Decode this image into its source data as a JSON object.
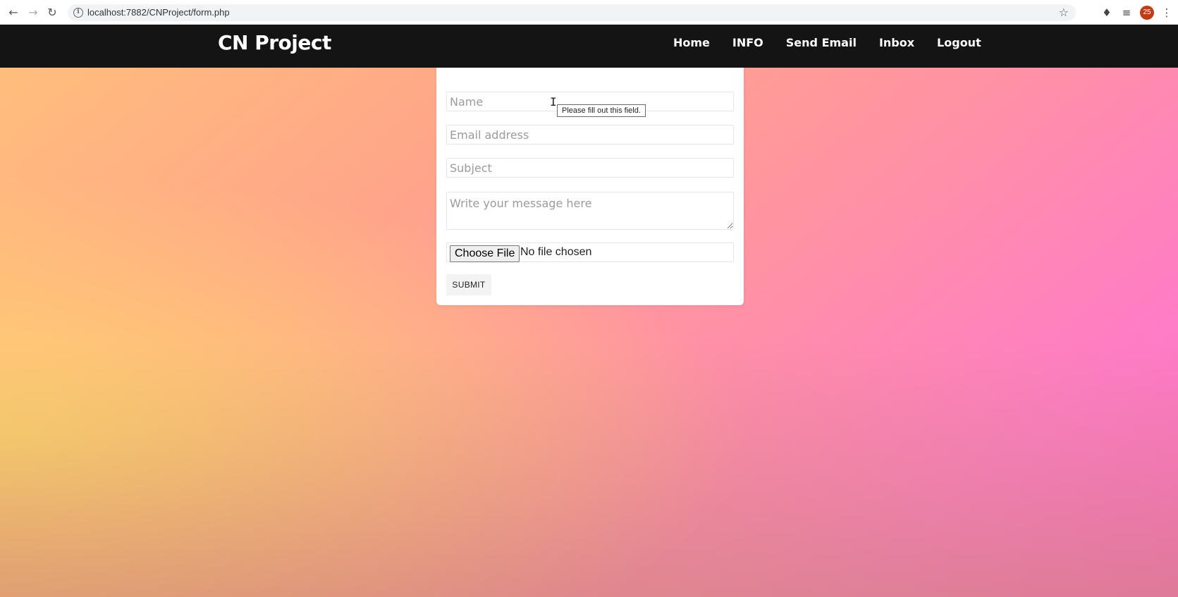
{
  "browser": {
    "url": "localhost:7882/CNProject/form.php",
    "profile_badge": "25"
  },
  "navbar": {
    "brand": "CN Project",
    "links": [
      "Home",
      "INFO",
      "Send Email",
      "Inbox",
      "Logout"
    ]
  },
  "form": {
    "name_placeholder": "Name",
    "email_placeholder": "Email address",
    "subject_placeholder": "Subject",
    "message_placeholder": "Write your message here",
    "file_button": "Choose File",
    "file_status": "No file chosen",
    "submit_label": "SUBMIT"
  },
  "tooltip": {
    "text": "Please fill out this field."
  },
  "icons": {
    "back": "arrow-left-icon",
    "forward": "arrow-right-icon",
    "reload": "reload-icon",
    "info": "info-icon",
    "bookmark": "star-icon",
    "extensions": "puzzle-icon",
    "media": "playlist-icon",
    "menu": "kebab-menu-icon"
  }
}
